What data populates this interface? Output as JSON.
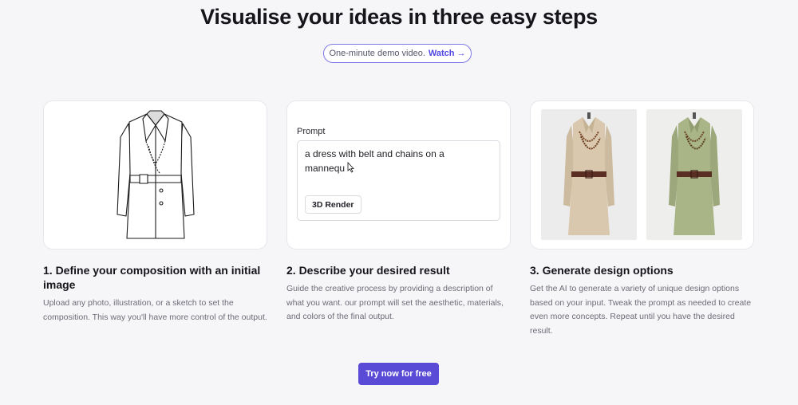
{
  "header": {
    "title": "Visualise your ideas in three easy steps",
    "demo_text": "One-minute demo video.",
    "watch_label": "Watch →"
  },
  "prompt_card": {
    "label": "Prompt",
    "text": "a dress with belt and chains on a mannequ",
    "render_button": "3D Render"
  },
  "steps": [
    {
      "title": "1. Define your composition with an initial image",
      "description": "Upload any photo, illustration, or a sketch to set the composition. This way you'll have more control of the output."
    },
    {
      "title": "2. Describe your desired result",
      "description": "Guide the creative process by providing a description of what you want. our prompt will set the aesthetic, materials, and colors of the final output."
    },
    {
      "title": "3. Generate design options",
      "description": "Get the AI to generate a variety of unique design options based on your input. Tweak the prompt as needed to create even more concepts. Repeat until you have the desired result."
    }
  ],
  "cta": {
    "label": "Try now for free"
  },
  "colors": {
    "accent": "#5a4bd6",
    "pill_border": "#7b78e6",
    "coat_beige": "#d9c8ad",
    "coat_sage": "#a9b487",
    "belt": "#5a2e22"
  }
}
